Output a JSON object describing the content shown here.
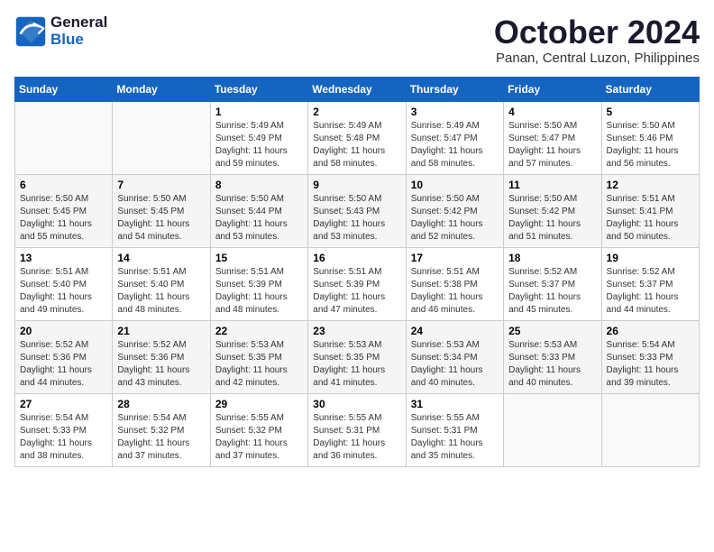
{
  "logo": {
    "line1": "General",
    "line2": "Blue"
  },
  "title": "October 2024",
  "subtitle": "Panan, Central Luzon, Philippines",
  "headers": [
    "Sunday",
    "Monday",
    "Tuesday",
    "Wednesday",
    "Thursday",
    "Friday",
    "Saturday"
  ],
  "weeks": [
    [
      {
        "day": "",
        "sunrise": "",
        "sunset": "",
        "daylight": ""
      },
      {
        "day": "",
        "sunrise": "",
        "sunset": "",
        "daylight": ""
      },
      {
        "day": "1",
        "sunrise": "Sunrise: 5:49 AM",
        "sunset": "Sunset: 5:49 PM",
        "daylight": "Daylight: 11 hours and 59 minutes."
      },
      {
        "day": "2",
        "sunrise": "Sunrise: 5:49 AM",
        "sunset": "Sunset: 5:48 PM",
        "daylight": "Daylight: 11 hours and 58 minutes."
      },
      {
        "day": "3",
        "sunrise": "Sunrise: 5:49 AM",
        "sunset": "Sunset: 5:47 PM",
        "daylight": "Daylight: 11 hours and 58 minutes."
      },
      {
        "day": "4",
        "sunrise": "Sunrise: 5:50 AM",
        "sunset": "Sunset: 5:47 PM",
        "daylight": "Daylight: 11 hours and 57 minutes."
      },
      {
        "day": "5",
        "sunrise": "Sunrise: 5:50 AM",
        "sunset": "Sunset: 5:46 PM",
        "daylight": "Daylight: 11 hours and 56 minutes."
      }
    ],
    [
      {
        "day": "6",
        "sunrise": "Sunrise: 5:50 AM",
        "sunset": "Sunset: 5:45 PM",
        "daylight": "Daylight: 11 hours and 55 minutes."
      },
      {
        "day": "7",
        "sunrise": "Sunrise: 5:50 AM",
        "sunset": "Sunset: 5:45 PM",
        "daylight": "Daylight: 11 hours and 54 minutes."
      },
      {
        "day": "8",
        "sunrise": "Sunrise: 5:50 AM",
        "sunset": "Sunset: 5:44 PM",
        "daylight": "Daylight: 11 hours and 53 minutes."
      },
      {
        "day": "9",
        "sunrise": "Sunrise: 5:50 AM",
        "sunset": "Sunset: 5:43 PM",
        "daylight": "Daylight: 11 hours and 53 minutes."
      },
      {
        "day": "10",
        "sunrise": "Sunrise: 5:50 AM",
        "sunset": "Sunset: 5:42 PM",
        "daylight": "Daylight: 11 hours and 52 minutes."
      },
      {
        "day": "11",
        "sunrise": "Sunrise: 5:50 AM",
        "sunset": "Sunset: 5:42 PM",
        "daylight": "Daylight: 11 hours and 51 minutes."
      },
      {
        "day": "12",
        "sunrise": "Sunrise: 5:51 AM",
        "sunset": "Sunset: 5:41 PM",
        "daylight": "Daylight: 11 hours and 50 minutes."
      }
    ],
    [
      {
        "day": "13",
        "sunrise": "Sunrise: 5:51 AM",
        "sunset": "Sunset: 5:40 PM",
        "daylight": "Daylight: 11 hours and 49 minutes."
      },
      {
        "day": "14",
        "sunrise": "Sunrise: 5:51 AM",
        "sunset": "Sunset: 5:40 PM",
        "daylight": "Daylight: 11 hours and 48 minutes."
      },
      {
        "day": "15",
        "sunrise": "Sunrise: 5:51 AM",
        "sunset": "Sunset: 5:39 PM",
        "daylight": "Daylight: 11 hours and 48 minutes."
      },
      {
        "day": "16",
        "sunrise": "Sunrise: 5:51 AM",
        "sunset": "Sunset: 5:39 PM",
        "daylight": "Daylight: 11 hours and 47 minutes."
      },
      {
        "day": "17",
        "sunrise": "Sunrise: 5:51 AM",
        "sunset": "Sunset: 5:38 PM",
        "daylight": "Daylight: 11 hours and 46 minutes."
      },
      {
        "day": "18",
        "sunrise": "Sunrise: 5:52 AM",
        "sunset": "Sunset: 5:37 PM",
        "daylight": "Daylight: 11 hours and 45 minutes."
      },
      {
        "day": "19",
        "sunrise": "Sunrise: 5:52 AM",
        "sunset": "Sunset: 5:37 PM",
        "daylight": "Daylight: 11 hours and 44 minutes."
      }
    ],
    [
      {
        "day": "20",
        "sunrise": "Sunrise: 5:52 AM",
        "sunset": "Sunset: 5:36 PM",
        "daylight": "Daylight: 11 hours and 44 minutes."
      },
      {
        "day": "21",
        "sunrise": "Sunrise: 5:52 AM",
        "sunset": "Sunset: 5:36 PM",
        "daylight": "Daylight: 11 hours and 43 minutes."
      },
      {
        "day": "22",
        "sunrise": "Sunrise: 5:53 AM",
        "sunset": "Sunset: 5:35 PM",
        "daylight": "Daylight: 11 hours and 42 minutes."
      },
      {
        "day": "23",
        "sunrise": "Sunrise: 5:53 AM",
        "sunset": "Sunset: 5:35 PM",
        "daylight": "Daylight: 11 hours and 41 minutes."
      },
      {
        "day": "24",
        "sunrise": "Sunrise: 5:53 AM",
        "sunset": "Sunset: 5:34 PM",
        "daylight": "Daylight: 11 hours and 40 minutes."
      },
      {
        "day": "25",
        "sunrise": "Sunrise: 5:53 AM",
        "sunset": "Sunset: 5:33 PM",
        "daylight": "Daylight: 11 hours and 40 minutes."
      },
      {
        "day": "26",
        "sunrise": "Sunrise: 5:54 AM",
        "sunset": "Sunset: 5:33 PM",
        "daylight": "Daylight: 11 hours and 39 minutes."
      }
    ],
    [
      {
        "day": "27",
        "sunrise": "Sunrise: 5:54 AM",
        "sunset": "Sunset: 5:33 PM",
        "daylight": "Daylight: 11 hours and 38 minutes."
      },
      {
        "day": "28",
        "sunrise": "Sunrise: 5:54 AM",
        "sunset": "Sunset: 5:32 PM",
        "daylight": "Daylight: 11 hours and 37 minutes."
      },
      {
        "day": "29",
        "sunrise": "Sunrise: 5:55 AM",
        "sunset": "Sunset: 5:32 PM",
        "daylight": "Daylight: 11 hours and 37 minutes."
      },
      {
        "day": "30",
        "sunrise": "Sunrise: 5:55 AM",
        "sunset": "Sunset: 5:31 PM",
        "daylight": "Daylight: 11 hours and 36 minutes."
      },
      {
        "day": "31",
        "sunrise": "Sunrise: 5:55 AM",
        "sunset": "Sunset: 5:31 PM",
        "daylight": "Daylight: 11 hours and 35 minutes."
      },
      {
        "day": "",
        "sunrise": "",
        "sunset": "",
        "daylight": ""
      },
      {
        "day": "",
        "sunrise": "",
        "sunset": "",
        "daylight": ""
      }
    ]
  ]
}
